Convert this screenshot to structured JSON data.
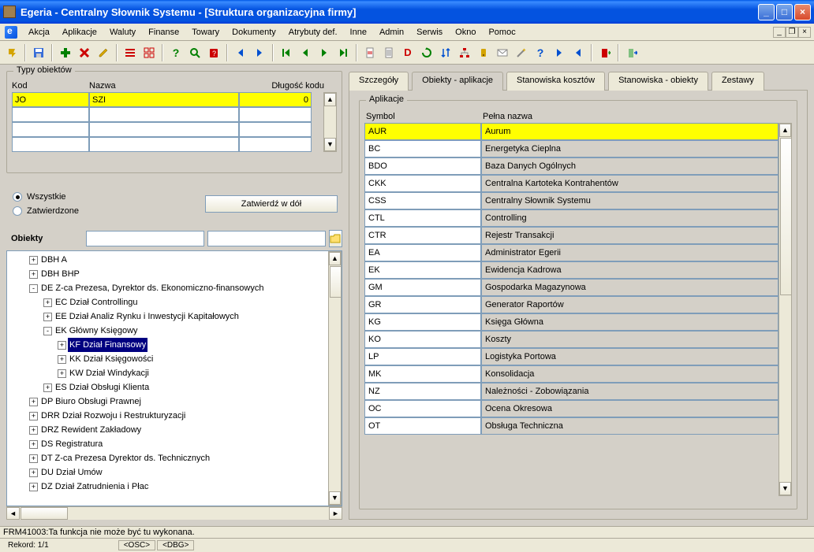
{
  "title": "Egeria - Centralny Słownik Systemu - [Struktura organizacyjna firmy]",
  "menu": [
    "Akcja",
    "Aplikacje",
    "Waluty",
    "Finanse",
    "Towary",
    "Dokumenty",
    "Atrybuty def.",
    "Inne",
    "Admin",
    "Serwis",
    "Okno",
    "Pomoc"
  ],
  "types": {
    "legend": "Typy obiektów",
    "headers": {
      "kod": "Kod",
      "nazwa": "Nazwa",
      "dlugosc": "Długość kodu"
    },
    "rows": [
      {
        "kod": "JO",
        "nazwa": "SZI",
        "dlugosc": "0",
        "sel": true
      },
      {
        "kod": "",
        "nazwa": "",
        "dlugosc": "",
        "sel": false
      },
      {
        "kod": "",
        "nazwa": "",
        "dlugosc": "",
        "sel": false
      },
      {
        "kod": "",
        "nazwa": "",
        "dlugosc": "",
        "sel": false
      }
    ]
  },
  "filter": {
    "all": "Wszystkie",
    "approved": "Zatwierdzone",
    "selected": "all",
    "confirm": "Zatwierdź w dół"
  },
  "objects_label": "Obiekty",
  "tree": [
    {
      "indent": 1,
      "pm": "+",
      "label": "DBH  A"
    },
    {
      "indent": 1,
      "pm": "+",
      "label": "DBH  BHP"
    },
    {
      "indent": 1,
      "pm": "-",
      "label": "DE  Z-ca Prezesa, Dyrektor ds. Ekonomiczno-finansowych"
    },
    {
      "indent": 2,
      "pm": "+",
      "label": "EC  Dział Controllingu"
    },
    {
      "indent": 2,
      "pm": "+",
      "label": "EE  Dział Analiz Rynku i Inwestycji Kapitałowych"
    },
    {
      "indent": 2,
      "pm": "-",
      "label": "EK  Główny Księgowy"
    },
    {
      "indent": 3,
      "pm": "+",
      "label": "KF  Dział Finansowy",
      "sel": true
    },
    {
      "indent": 3,
      "pm": "+",
      "label": "KK  Dział Księgowości"
    },
    {
      "indent": 3,
      "pm": "+",
      "label": "KW  Dział Windykacji"
    },
    {
      "indent": 2,
      "pm": "+",
      "label": "ES  Dział Obsługi Klienta"
    },
    {
      "indent": 1,
      "pm": "+",
      "label": "DP  Biuro Obsługi Prawnej"
    },
    {
      "indent": 1,
      "pm": "+",
      "label": "DRR  Dział Rozwoju i Restrukturyzacji"
    },
    {
      "indent": 1,
      "pm": "+",
      "label": "DRZ  Rewident Zakładowy"
    },
    {
      "indent": 1,
      "pm": "+",
      "label": "DS  Registratura"
    },
    {
      "indent": 1,
      "pm": "+",
      "label": "DT  Z-ca Prezesa Dyrektor ds. Technicznych"
    },
    {
      "indent": 1,
      "pm": "+",
      "label": "DU  Dział Umów"
    },
    {
      "indent": 1,
      "pm": "+",
      "label": "DZ  Dział Zatrudnienia i Płac"
    }
  ],
  "tabs": [
    "Szczegóły",
    "Obiekty - aplikacje",
    "Stanowiska kosztów",
    "Stanowiska - obiekty",
    "Zestawy"
  ],
  "active_tab": 1,
  "apps": {
    "legend": "Aplikacje",
    "headers": {
      "sym": "Symbol",
      "name": "Pełna nazwa"
    },
    "rows": [
      {
        "sym": "AUR",
        "name": "Aurum",
        "sel": true
      },
      {
        "sym": "BC",
        "name": "Energetyka Cieplna"
      },
      {
        "sym": "BDO",
        "name": "Baza Danych Ogólnych"
      },
      {
        "sym": "CKK",
        "name": "Centralna Kartoteka Kontrahentów"
      },
      {
        "sym": "CSS",
        "name": "Centralny Słownik Systemu"
      },
      {
        "sym": "CTL",
        "name": "Controlling"
      },
      {
        "sym": "CTR",
        "name": "Rejestr Transakcji"
      },
      {
        "sym": "EA",
        "name": "Administrator Egerii"
      },
      {
        "sym": "EK",
        "name": "Ewidencja Kadrowa"
      },
      {
        "sym": "GM",
        "name": "Gospodarka Magazynowa"
      },
      {
        "sym": "GR",
        "name": "Generator Raportów"
      },
      {
        "sym": "KG",
        "name": "Księga Główna"
      },
      {
        "sym": "KO",
        "name": "Koszty"
      },
      {
        "sym": "LP",
        "name": "Logistyka Portowa"
      },
      {
        "sym": "MK",
        "name": "Konsolidacja"
      },
      {
        "sym": "NZ",
        "name": "Należności - Zobowiązania"
      },
      {
        "sym": "OC",
        "name": "Ocena Okresowa"
      },
      {
        "sym": "OT",
        "name": "Obsługa Techniczna"
      }
    ]
  },
  "status": {
    "msg": "FRM41003:Ta funkcja nie może być tu wykonana.",
    "rekord": "Rekord: 1/1",
    "osc": "<OSC>",
    "dbg": "<DBG>"
  }
}
